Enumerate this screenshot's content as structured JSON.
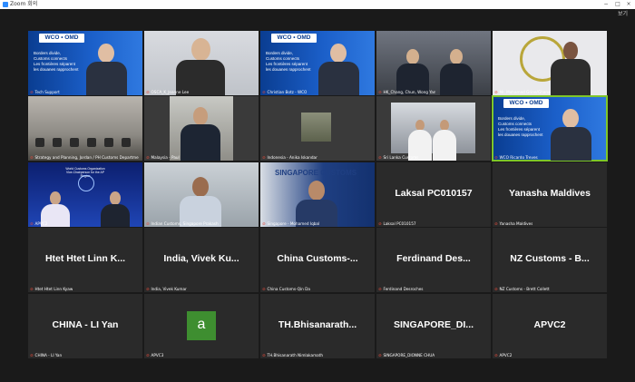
{
  "window": {
    "title": "Zoom 회의",
    "minimize": "−",
    "maximize": "□",
    "close": "×",
    "view_label": "보기"
  },
  "tiles": [
    {
      "name": "Tech Support",
      "type": "video",
      "scene": "wco"
    },
    {
      "name": "OSCA_K_Joanne Lee",
      "type": "video",
      "scene": "wall"
    },
    {
      "name": "Christian Botz - WCO",
      "type": "video",
      "scene": "wco"
    },
    {
      "name": "HK_Chang, Chun, Wong Yan",
      "type": "video",
      "scene": "office"
    },
    {
      "name": "Mr. Mohamed Grine/Ghana",
      "type": "video",
      "scene": "white"
    },
    {
      "name": "Strategy and Planning, Jordan / PH Customs Department",
      "type": "video",
      "scene": "room"
    },
    {
      "name": "Malaysia - Paul",
      "type": "video",
      "scene": "gray"
    },
    {
      "name": "Indonesia - Anika Iskandar",
      "type": "video",
      "scene": "gray"
    },
    {
      "name": "Sri Lanka Customs",
      "type": "video",
      "scene": "gray"
    },
    {
      "name": "WCO Ricardo Treves",
      "type": "video",
      "scene": "wco",
      "active": true
    },
    {
      "name": "APVC2",
      "type": "video",
      "scene": "blueevent"
    },
    {
      "name": "Indian Customs, Singapore Prakash",
      "type": "video",
      "scene": "lab"
    },
    {
      "name": "Singapore - Mohamed Iqbal",
      "type": "video",
      "scene": "sg"
    },
    {
      "name": "Laksal PC010157",
      "type": "text",
      "big": "Laksal PC010157"
    },
    {
      "name": "Yanasha Maldives",
      "type": "text",
      "big": "Yanasha Maldives"
    },
    {
      "name": "Htet Htet Linn Kyaw",
      "type": "text",
      "big": "Htet Htet Linn K..."
    },
    {
      "name": "India, Vivek Kumar",
      "type": "text",
      "big": "India, Vivek Ku..."
    },
    {
      "name": "China Customs-Qin Da",
      "type": "text",
      "big": "China Customs-..."
    },
    {
      "name": "Ferdinand Desroches",
      "type": "text",
      "big": "Ferdinand Des..."
    },
    {
      "name": "NZ Customs - Brett Collett",
      "type": "text",
      "big": "NZ Customs - B..."
    },
    {
      "name": "CHINA - LI Yan",
      "type": "text",
      "big": "CHINA - LI Yan"
    },
    {
      "name": "APVC3",
      "type": "avatar",
      "big": "a"
    },
    {
      "name": "TH.Bhisanarath Nimlakamath",
      "type": "text",
      "big": "TH.Bhisanarath..."
    },
    {
      "name": "SINGAPORE_DIONNE CHUA",
      "type": "text",
      "big": "SINGAPORE_DI..."
    },
    {
      "name": "APVC2",
      "type": "text",
      "big": "APVC2"
    }
  ],
  "wco": {
    "logo": "WCO • OMD",
    "line1": "Borders divide,",
    "line2": "Customs connects",
    "line3": "Les frontières séparent",
    "line4": "les douanes rapprochent"
  },
  "singapore_banner": "SINGAPORE CUSTOMS",
  "event_banner": "World Customs Organization Vice-Chairperson for the AP Region"
}
